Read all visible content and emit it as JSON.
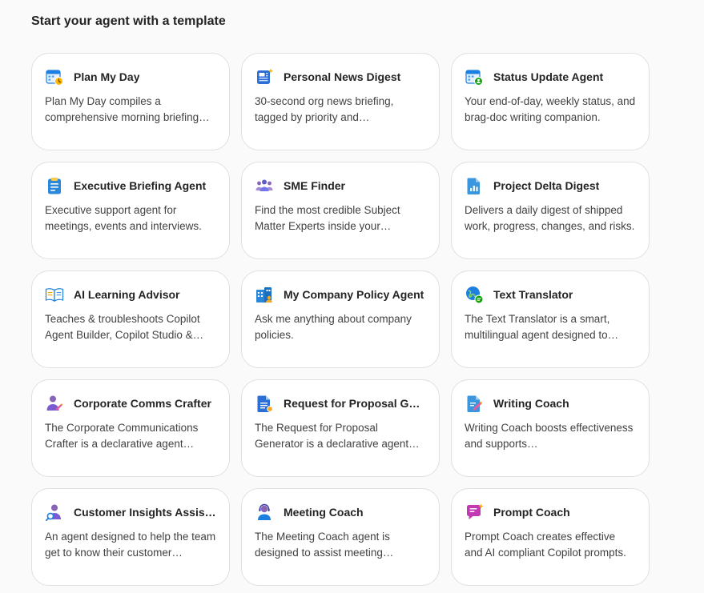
{
  "heading": "Start your agent with a template",
  "templates": [
    {
      "title": "Plan My Day",
      "description": "Plan My Day compiles a comprehensive morning briefing…",
      "icon": "calendar-clock-icon"
    },
    {
      "title": "Personal News Digest",
      "description": "30-second org news briefing, tagged by priority and…",
      "icon": "news-sparkle-icon"
    },
    {
      "title": "Status Update Agent",
      "description": "Your end-of-day, weekly status, and brag-doc writing companion.",
      "icon": "calendar-person-icon"
    },
    {
      "title": "Executive Briefing Agent",
      "description": "Executive support agent for meetings, events and interviews.",
      "icon": "clipboard-icon"
    },
    {
      "title": "SME Finder",
      "description": "Find the most credible Subject Matter Experts inside your…",
      "icon": "people-group-icon"
    },
    {
      "title": "Project Delta Digest",
      "description": "Delivers a daily digest of shipped work, progress, changes, and risks.",
      "icon": "document-chart-icon"
    },
    {
      "title": "AI Learning Advisor",
      "description": "Teaches & troubleshoots Copilot Agent Builder, Copilot Studio &…",
      "icon": "book-open-icon"
    },
    {
      "title": "My Company Policy Agent",
      "description": "Ask me anything about company policies.",
      "icon": "building-person-icon"
    },
    {
      "title": "Text Translator",
      "description": "The Text Translator is a smart, multilingual agent designed to…",
      "icon": "globe-chat-icon"
    },
    {
      "title": "Corporate Comms Crafter",
      "description": "The Corporate Communications Crafter is a declarative agent…",
      "icon": "person-edit-icon"
    },
    {
      "title": "Request for Proposal Gen…",
      "description": "The Request for Proposal Generator is a declarative agent…",
      "icon": "document-lines-icon"
    },
    {
      "title": "Writing Coach",
      "description": "Writing Coach boosts effectiveness and supports…",
      "icon": "document-pen-icon"
    },
    {
      "title": "Customer Insights Assistant",
      "description": "An agent designed to help the team get to know their customer…",
      "icon": "person-search-icon"
    },
    {
      "title": "Meeting Coach",
      "description": "The Meeting Coach agent is designed to assist meeting…",
      "icon": "person-headset-icon"
    },
    {
      "title": "Prompt Coach",
      "description": "Prompt Coach creates effective and AI compliant Copilot prompts.",
      "icon": "chat-sparkle-icon"
    }
  ]
}
